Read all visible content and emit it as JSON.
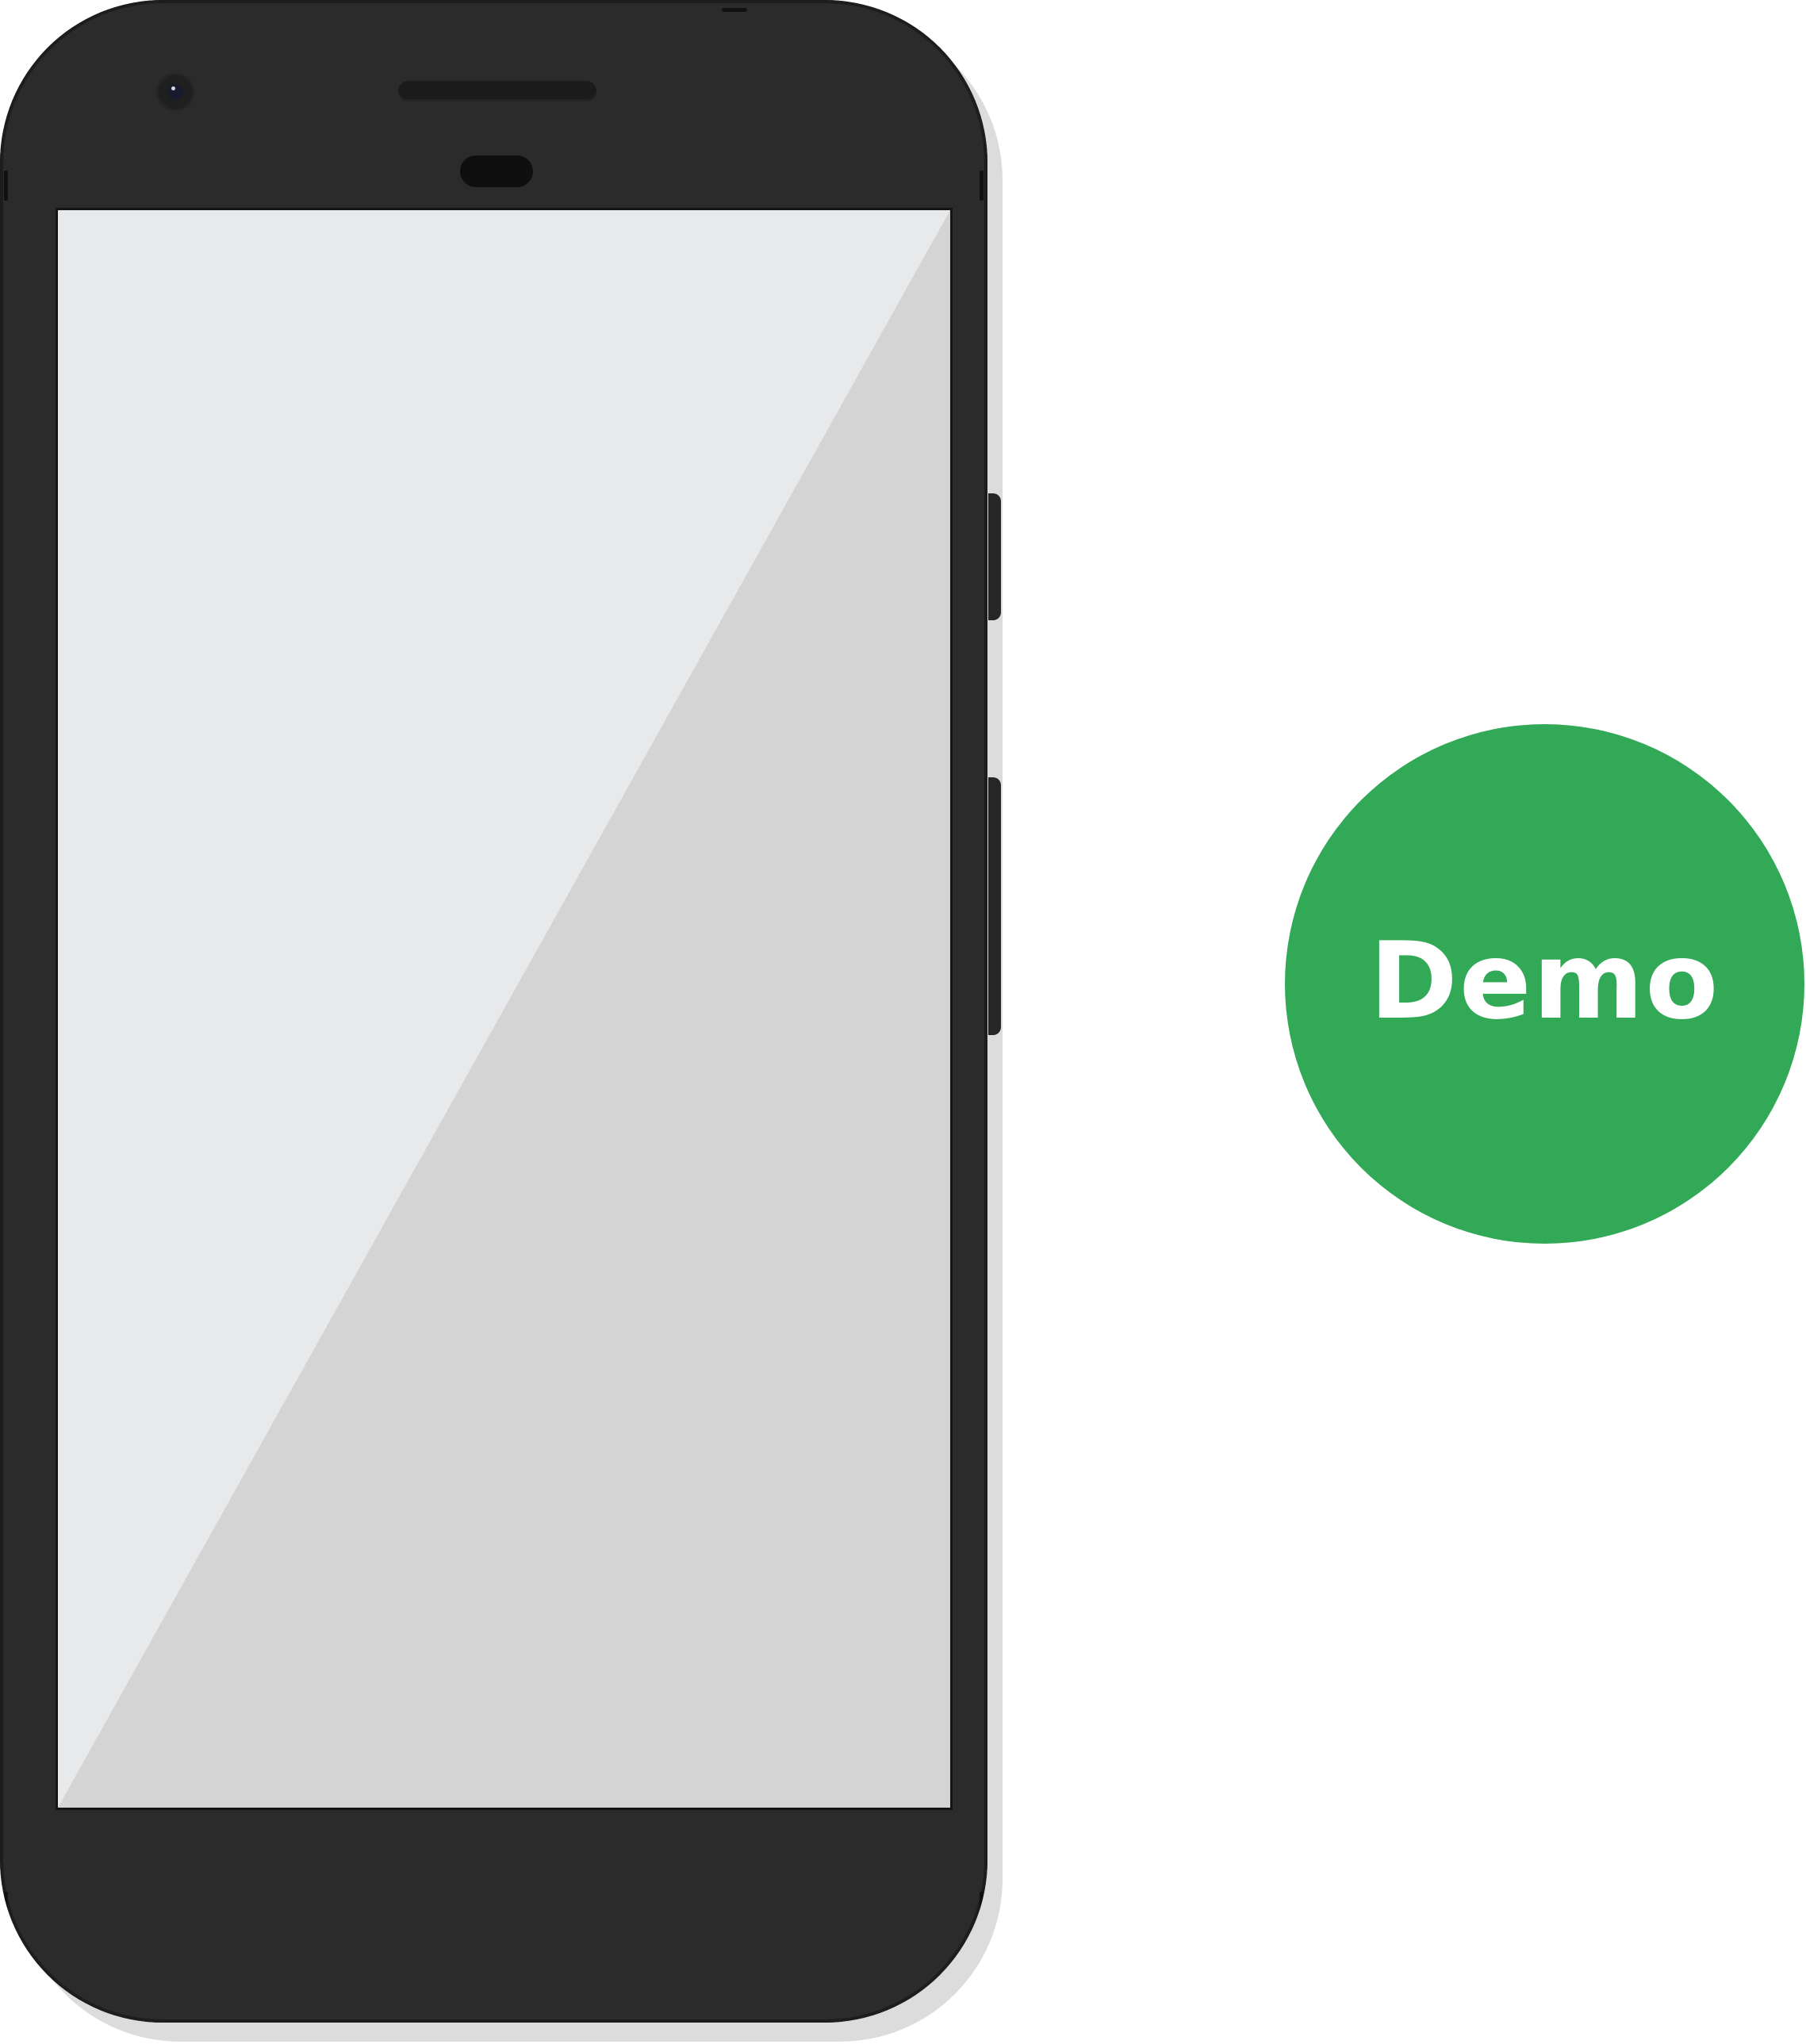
{
  "device": {
    "type": "Android smartphone mockup",
    "body_color": "#2b2b2b",
    "screen_light_color": "#e8e9eb",
    "screen_glare_color": "#d4d4d4"
  },
  "badge": {
    "label": "Demo",
    "color": "#31a956",
    "text_color": "#ffffff"
  }
}
